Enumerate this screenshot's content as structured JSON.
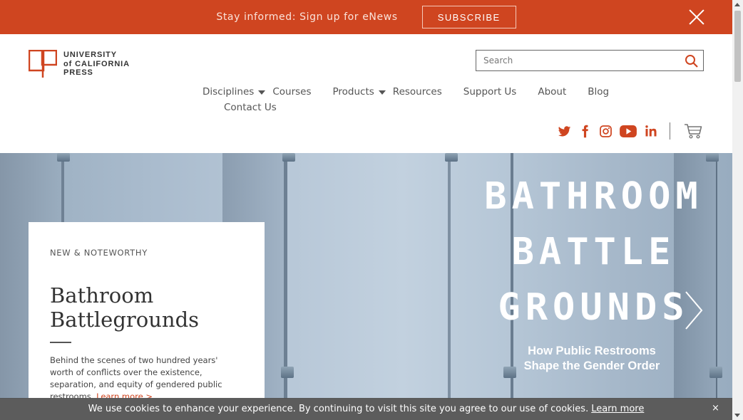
{
  "banner": {
    "message": "Stay informed: Sign up for eNews",
    "subscribe_label": "SUBSCRIBE",
    "accent_color": "#cf4520"
  },
  "logo": {
    "line1": "UNIVERSITY",
    "line2": "of CALIFORNIA",
    "line3": "PRESS"
  },
  "search": {
    "placeholder": "Search",
    "icon": "search-icon"
  },
  "nav": {
    "disciplines": "Disciplines",
    "courses": "Courses",
    "products": "Products",
    "resources": "Resources",
    "support": "Support Us",
    "about": "About",
    "blog": "Blog",
    "contact": "Contact Us"
  },
  "social": {
    "icons": [
      "twitter-icon",
      "facebook-icon",
      "instagram-icon",
      "youtube-icon",
      "linkedin-icon"
    ],
    "color": "#cf4520",
    "cart_icon": "cart-icon"
  },
  "hero": {
    "eyebrow": "NEW & NOTEWORTHY",
    "title": "Bathroom Battlegrounds",
    "description": "Behind the scenes of two hundred years' worth of conflicts over the existence, separation, and equity of gendered public restrooms.",
    "learn_more": "Learn more >",
    "book_title_line1": "BATHROOM",
    "book_title_line2": "BATTLE",
    "book_title_line3": "GROUNDS",
    "book_subtitle_line1": "How Public Restrooms",
    "book_subtitle_line2": "Shape the Gender Order"
  },
  "cookie": {
    "message": "We use cookies to enhance your experience. By continuing to visit this site you agree to our use of cookies.",
    "learn_more": "Learn more",
    "close": "×"
  }
}
